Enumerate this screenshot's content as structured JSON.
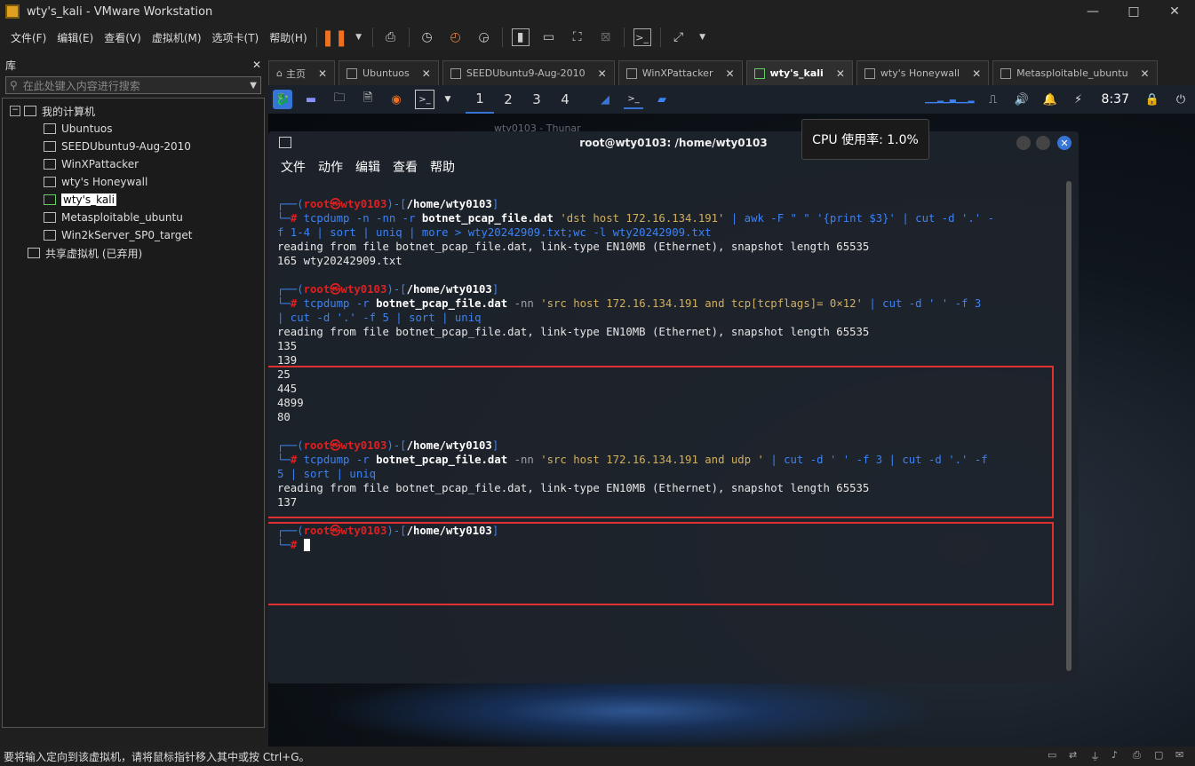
{
  "window": {
    "title": "wty's_kali - VMware Workstation"
  },
  "menubar": {
    "items": [
      "文件(F)",
      "编辑(E)",
      "查看(V)",
      "虚拟机(M)",
      "选项卡(T)",
      "帮助(H)"
    ]
  },
  "library": {
    "title": "库",
    "search_placeholder": "在此处键入内容进行搜索",
    "root": "我的计算机",
    "vms": [
      "Ubuntuos",
      "SEEDUbuntu9-Aug-2010",
      "WinXPattacker",
      "wty's Honeywall",
      "wty's_kali",
      "Metasploitable_ubuntu",
      "Win2kServer_SP0_target"
    ],
    "selected_vm": "wty's_kali",
    "shared": "共享虚拟机 (已弃用)"
  },
  "tabs": [
    "主页",
    "Ubuntuos",
    "SEEDUbuntu9-Aug-2010",
    "WinXPattacker",
    "wty's_kali",
    "wty's Honeywall",
    "Metasploitable_ubuntu"
  ],
  "active_tab": "wty's_kali",
  "kali_panel": {
    "workspaces": [
      "1",
      "2",
      "3",
      "4"
    ],
    "active_workspace": "1",
    "clock": "8:37"
  },
  "thunar_title": "wty0103 - Thunar",
  "cpu_tooltip": "CPU 使用率: 1.0%",
  "terminal": {
    "title": "root@wty0103: /home/wty0103",
    "menu": [
      "文件",
      "动作",
      "编辑",
      "查看",
      "帮助"
    ],
    "prompt_user": "root㉿wty0103",
    "prompt_path": "/home/wty0103",
    "cmd1_a": "tcpdump -n -nn -r",
    "cmd1_file": "botnet_pcap_file.dat",
    "cmd1_b": "'dst host 172.16.134.191'",
    "cmd1_c": "| awk -F \" \" '{print $3}' | cut -d '.' -",
    "cmd1_d": "f 1-4 | sort | uniq | more > wty20242909.txt;wc -l wty20242909.txt",
    "out_reading": "reading from file botnet_pcap_file.dat, link-type EN10MB (Ethernet), snapshot length 65535",
    "out1": "165 wty20242909.txt",
    "cmd2_a": "tcpdump -r",
    "cmd2_file": "botnet_pcap_file.dat",
    "cmd2_b": "-nn",
    "cmd2_c": "'src host 172.16.134.191 and tcp[tcpflags]= 0×12'",
    "cmd2_d": "| cut -d ' ' -f 3",
    "cmd2_e": "| cut -d '.' -f 5 | sort | uniq",
    "out2": [
      "135",
      "139",
      "25",
      "445",
      "4899",
      "80"
    ],
    "cmd3_a": "tcpdump -r",
    "cmd3_file": "botnet_pcap_file.dat",
    "cmd3_b": "-nn",
    "cmd3_c": "'src host 172.16.134.191 and udp '",
    "cmd3_d": "| cut -d ' ' -f 3 | cut -d '.' -f",
    "cmd3_e": "5 | sort | uniq",
    "out3": "137"
  },
  "statusbar": {
    "text": "要将输入定向到该虚拟机，请将鼠标指针移入其中或按 Ctrl+G。"
  },
  "colors": {
    "accent": "#3675d6",
    "highlight_box": "#e03030",
    "prompt_red": "#e02020"
  }
}
